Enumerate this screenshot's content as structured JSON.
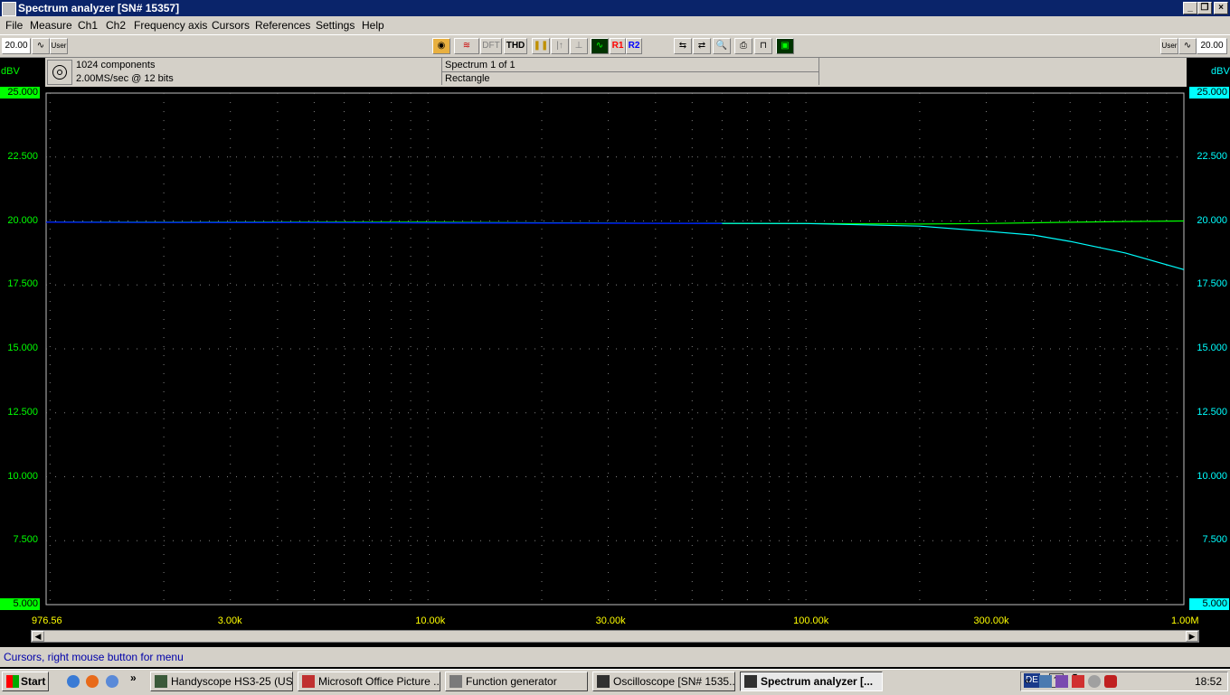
{
  "window": {
    "title": "Spectrum analyzer  [SN# 15357]"
  },
  "menu": [
    "File",
    "Measure",
    "Ch1",
    "Ch2",
    "Frequency axis",
    "Cursors",
    "References",
    "Settings",
    "Help"
  ],
  "toolbar": {
    "left_value": "20.00",
    "left_mode": "User",
    "dft_label": "DFT",
    "thd_label": "THD",
    "r1_label": "R1",
    "r2_label": "R2",
    "right_mode": "User",
    "right_value": "20.00"
  },
  "info": {
    "components": "1024 components",
    "sample_rate": "2.00MS/sec @ 12 bits",
    "spectrum": "Spectrum 1 of 1",
    "window_fn": "Rectangle"
  },
  "chart_data": {
    "type": "line",
    "y_unit_left": "dBV",
    "y_unit_right": "dBV",
    "ylim": [
      5,
      25
    ],
    "xlim": [
      976.56,
      1000000
    ],
    "x_scale": "log",
    "grid": true,
    "yticks": [
      "25.000",
      "22.500",
      "20.000",
      "17.500",
      "15.000",
      "12.500",
      "10.000",
      "7.500",
      "5.000"
    ],
    "xticks": [
      {
        "value": 976.56,
        "label": "976.56"
      },
      {
        "value": 3000,
        "label": "3.00k"
      },
      {
        "value": 10000,
        "label": "10.00k"
      },
      {
        "value": 30000,
        "label": "30.00k"
      },
      {
        "value": 100000,
        "label": "100.00k"
      },
      {
        "value": 300000,
        "label": "300.00k"
      },
      {
        "value": 1000000,
        "label": "1.00M"
      }
    ],
    "series": [
      {
        "color": "#00ff00",
        "points": [
          [
            976.56,
            19.95
          ],
          [
            10000,
            19.95
          ],
          [
            50000,
            19.9
          ],
          [
            100000,
            19.9
          ],
          [
            200000,
            19.88
          ],
          [
            300000,
            19.9
          ],
          [
            400000,
            19.93
          ],
          [
            500000,
            19.95
          ],
          [
            700000,
            19.98
          ],
          [
            1000000,
            20.0
          ]
        ]
      },
      {
        "color": "#00ffff",
        "points": [
          [
            976.56,
            19.95
          ],
          [
            100000,
            19.9
          ],
          [
            200000,
            19.8
          ],
          [
            300000,
            19.6
          ],
          [
            400000,
            19.45
          ],
          [
            500000,
            19.2
          ],
          [
            700000,
            18.75
          ],
          [
            1000000,
            18.1
          ]
        ]
      },
      {
        "color": "#0000ff",
        "points": [
          [
            976.56,
            19.95
          ],
          [
            60000,
            19.9
          ]
        ]
      }
    ]
  },
  "status": "Cursors, right mouse button for menu",
  "taskbar": {
    "start": "Start",
    "tasks": [
      "Handyscope HS3-25 (US...",
      "Microsoft Office Picture ...",
      "Function generator",
      "Oscilloscope  [SN# 1535...",
      "Spectrum analyzer  [..."
    ],
    "lang": "DE",
    "clock": "18:52"
  },
  "colors": {
    "ch1": "#00ff00",
    "ch2": "#00ffff",
    "ref": "#0000ff",
    "xaxis": "#ffff00"
  }
}
